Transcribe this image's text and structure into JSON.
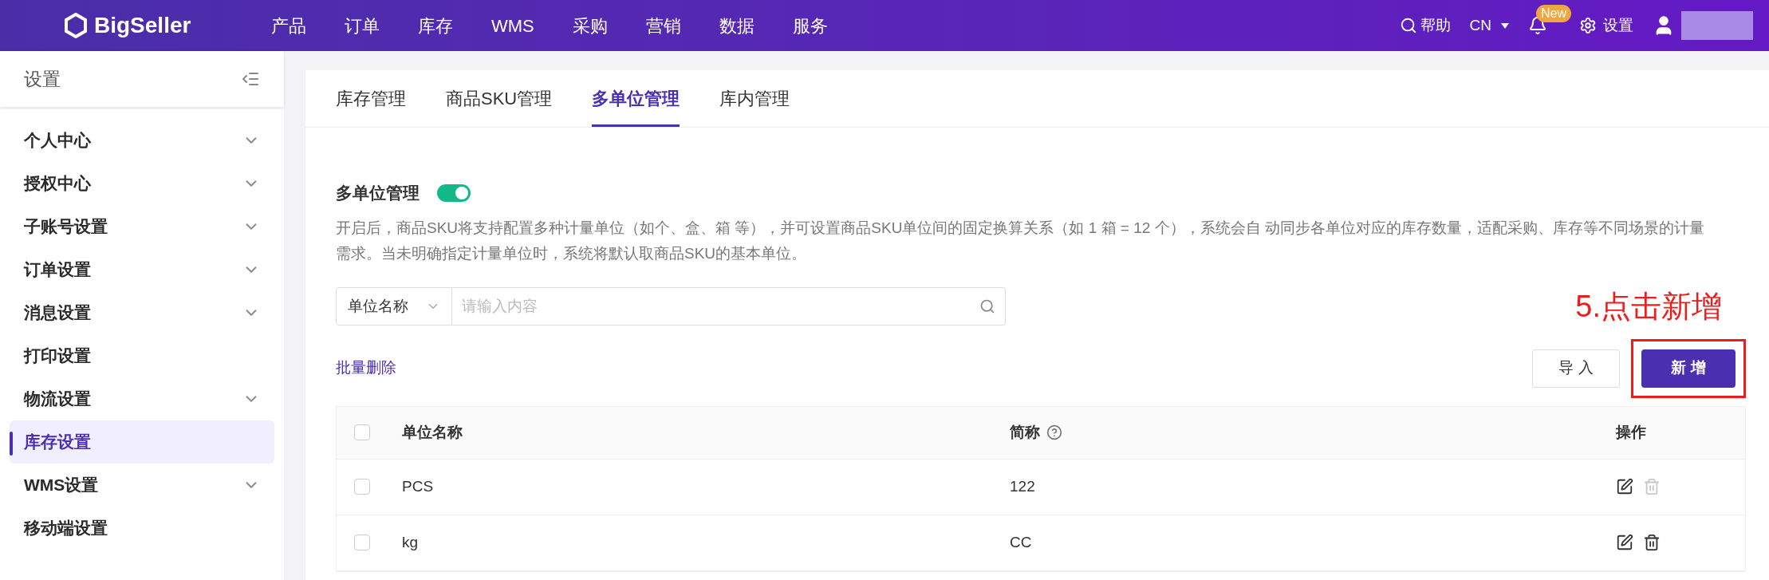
{
  "topbar": {
    "logo": "BigSeller",
    "nav": [
      "产品",
      "订单",
      "库存",
      "WMS",
      "采购",
      "营销",
      "数据",
      "服务"
    ],
    "help": "帮助",
    "language": "CN",
    "badge": "New",
    "settings": "设置"
  },
  "sidebar": {
    "title": "设置",
    "items": [
      {
        "label": "个人中心",
        "expandable": true,
        "selected": false
      },
      {
        "label": "授权中心",
        "expandable": true,
        "selected": false
      },
      {
        "label": "子账号设置",
        "expandable": true,
        "selected": false
      },
      {
        "label": "订单设置",
        "expandable": true,
        "selected": false
      },
      {
        "label": "消息设置",
        "expandable": true,
        "selected": false
      },
      {
        "label": "打印设置",
        "expandable": false,
        "selected": false
      },
      {
        "label": "物流设置",
        "expandable": true,
        "selected": false
      },
      {
        "label": "库存设置",
        "expandable": false,
        "selected": true
      },
      {
        "label": "WMS设置",
        "expandable": true,
        "selected": false
      },
      {
        "label": "移动端设置",
        "expandable": false,
        "selected": false
      }
    ]
  },
  "tabs": [
    {
      "label": "库存管理",
      "selected": false
    },
    {
      "label": "商品SKU管理",
      "selected": false
    },
    {
      "label": "多单位管理",
      "selected": true
    },
    {
      "label": "库内管理",
      "selected": false
    }
  ],
  "section": {
    "title": "多单位管理",
    "on": true,
    "description": "开启后，商品SKU将支持配置多种计量单位（如个、盒、箱 等），并可设置商品SKU单位间的固定换算关系（如 1 箱 = 12 个），系统会自 动同步各单位对应的库存数量，适配采购、库存等不同场景的计量需求。当未明确指定计量单位时，系统将默认取商品SKU的基本单位。"
  },
  "search": {
    "filter": "单位名称",
    "placeholder": "请输入内容"
  },
  "batch_delete": "批量删除",
  "buttons": {
    "import": "导 入",
    "add": "新 增"
  },
  "annotation": "5.点击新增",
  "table": {
    "all_checked": false,
    "columns": [
      "单位名称",
      "简称",
      "操作"
    ],
    "rows": [
      {
        "name": "PCS",
        "short": "122",
        "checked": false,
        "delete_disabled": true
      },
      {
        "name": "kg",
        "short": "CC",
        "checked": false,
        "delete_disabled": false
      }
    ]
  }
}
